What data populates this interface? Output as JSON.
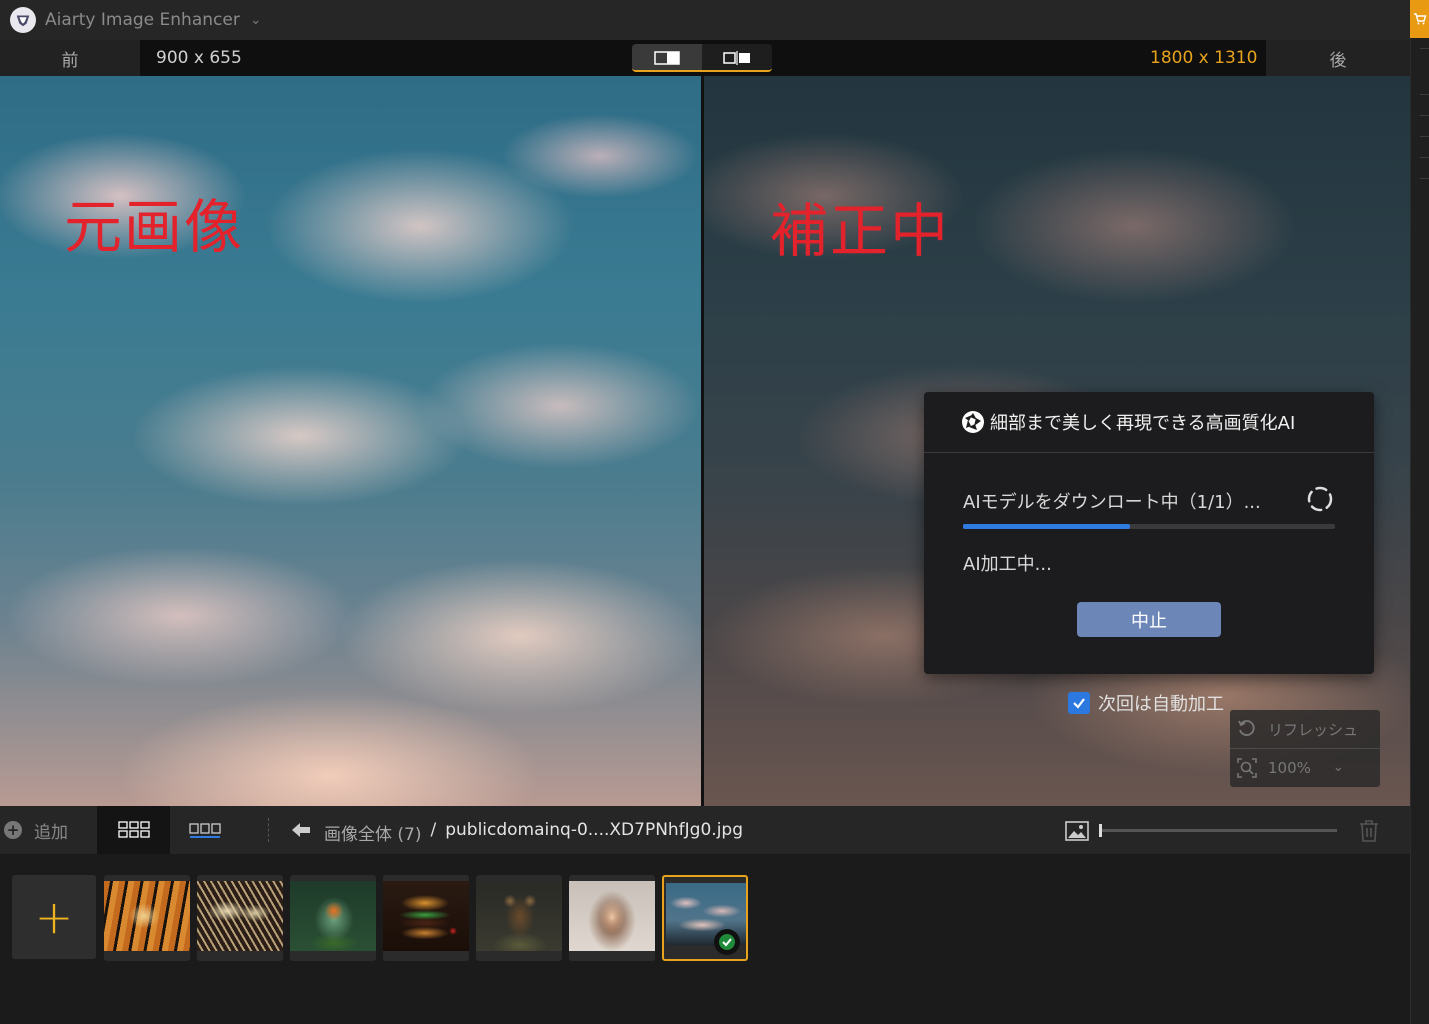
{
  "app": {
    "title": "Aiarty Image Enhancer"
  },
  "compare": {
    "before_label": "前",
    "before_size": "900 x 655",
    "after_size": "1800 x 1310",
    "after_label": "後"
  },
  "panes": {
    "left_label": "元画像",
    "right_label": "補正中"
  },
  "dialog": {
    "title": "細部まで美しく再現できる高画質化AI",
    "download_status": "AIモデルをダウンロート中（1/1）...",
    "download_progress": 0.45,
    "ai_status": "AI加工中...",
    "stop_label": "中止",
    "progress_color": "#2f7be0"
  },
  "auto_process": {
    "label": "次回は自動加工",
    "checked": true
  },
  "zoom_panel": {
    "refresh_label": "リフレッシュ",
    "zoom_value": "100%"
  },
  "toolbar": {
    "add_label": "追加",
    "breadcrumb_root": "画像全体 (7)",
    "breadcrumb_sep": "/",
    "breadcrumb_file": "publicdomainq-0....XD7PNhfJg0.jpg"
  },
  "thumbnails": [
    {
      "name": "tiger"
    },
    {
      "name": "butterfly"
    },
    {
      "name": "terrarium"
    },
    {
      "name": "burger"
    },
    {
      "name": "steampunk-dog"
    },
    {
      "name": "portrait"
    },
    {
      "name": "sky",
      "selected": true,
      "done": true
    }
  ],
  "colors": {
    "accent": "#e8a31e",
    "label_red": "#e4222c",
    "stop_button": "#6c86b8"
  }
}
